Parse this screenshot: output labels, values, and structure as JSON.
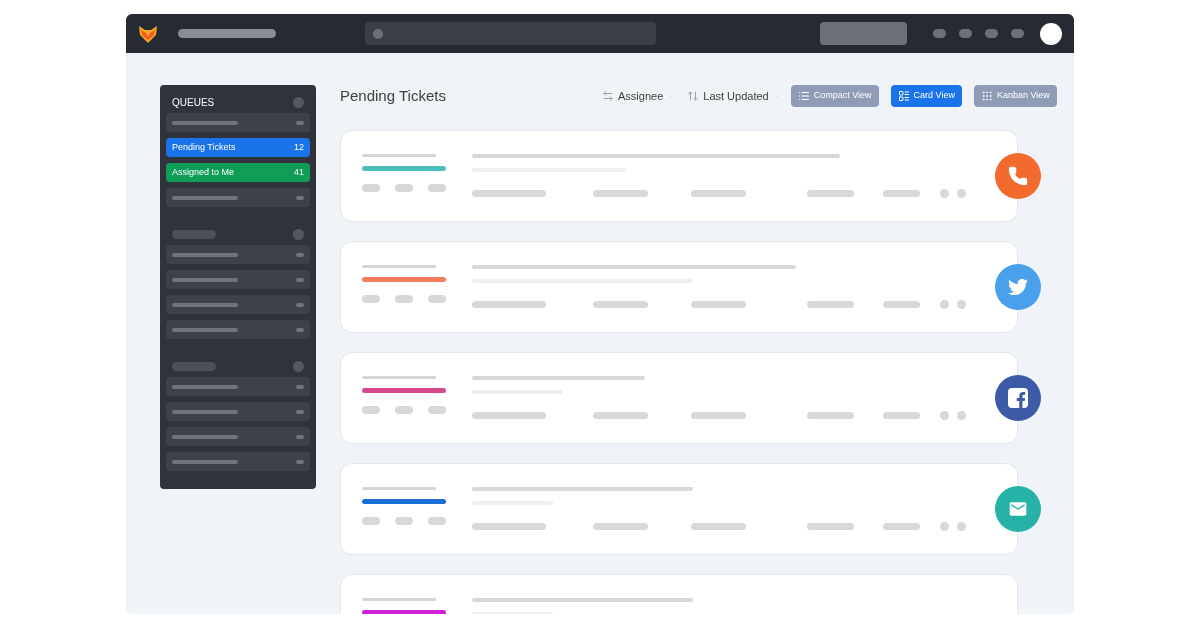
{
  "sidebar": {
    "groups": [
      {
        "title": "QUEUES",
        "items": [
          {
            "kind": "placeholder"
          },
          {
            "kind": "queue",
            "label": "Pending Tickets",
            "count": "12",
            "color": "#1a73e8"
          },
          {
            "kind": "queue",
            "label": "Assigned to Me",
            "count": "41",
            "color": "#0f9d58"
          },
          {
            "kind": "placeholder"
          }
        ]
      },
      {
        "items": [
          {
            "kind": "placeholder"
          },
          {
            "kind": "placeholder"
          },
          {
            "kind": "placeholder"
          },
          {
            "kind": "placeholder"
          }
        ]
      },
      {
        "items": [
          {
            "kind": "placeholder"
          },
          {
            "kind": "placeholder"
          },
          {
            "kind": "placeholder"
          },
          {
            "kind": "placeholder"
          }
        ]
      }
    ]
  },
  "page_title": "Pending Tickets",
  "sorts": [
    {
      "label": "Assignee",
      "kind": "swap"
    },
    {
      "label": "Last Updated",
      "kind": "order"
    }
  ],
  "views": [
    {
      "label": "Compact View",
      "kind": "compact",
      "selected": false
    },
    {
      "label": "Card View",
      "kind": "card",
      "selected": true
    },
    {
      "label": "Kanban View",
      "kind": "kanban",
      "selected": false
    }
  ],
  "tickets": [
    {
      "color": "#4bbdbd",
      "kind": "phone"
    },
    {
      "color": "#f47b5b",
      "kind": "twitter"
    },
    {
      "color": "#d9488b",
      "kind": "facebook"
    },
    {
      "color": "#1a6fd6",
      "kind": "email"
    },
    {
      "color": "#d021d6"
    }
  ]
}
